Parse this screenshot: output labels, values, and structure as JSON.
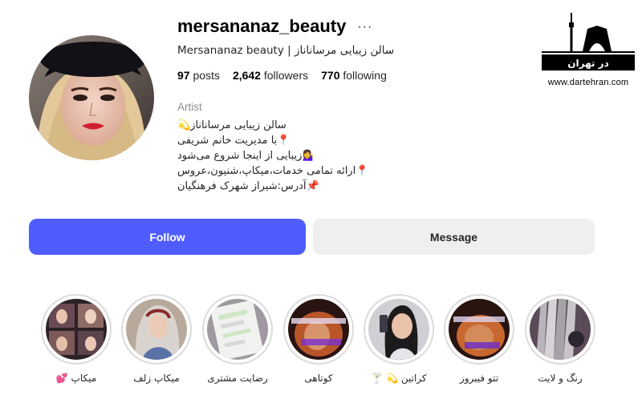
{
  "profile": {
    "username": "mersananaz_beauty",
    "more_icon": "···",
    "full_name": "Mersananaz beauty | سالن زیبایی مرساناناز",
    "stats": {
      "posts_count": "97",
      "posts_label": "posts",
      "followers_count": "2,642",
      "followers_label": "followers",
      "following_count": "770",
      "following_label": "following"
    },
    "category": "Artist",
    "bio_lines": [
      "سالن زیبایی مرساناناز💫",
      "📍با مدیریت خانم شریفی",
      "💁‍♀️زیبایی از اینجا شروع می‌شود",
      "📍ارائه تمامی خدمات،میکاپ،شنیون،عروس",
      "📌آدرس:شیراز شهرک فرهنگیان"
    ]
  },
  "watermark": {
    "logo_text": "در تهران",
    "url": "www.dartehran.com"
  },
  "actions": {
    "follow_label": "Follow",
    "message_label": "Message"
  },
  "highlights": [
    {
      "label": "رنگ و لایت"
    },
    {
      "label": "تتو فیبروز"
    },
    {
      "label": "کراتین 💫 🍸"
    },
    {
      "label": "کوتاهی"
    },
    {
      "label": "رضایت مشتری"
    },
    {
      "label": "میکاپ زلف"
    },
    {
      "label": "میکاپ 💕"
    }
  ],
  "colors": {
    "follow_button": "#4f5dff",
    "message_button": "#efefef",
    "ring": "#dbdbdb"
  }
}
